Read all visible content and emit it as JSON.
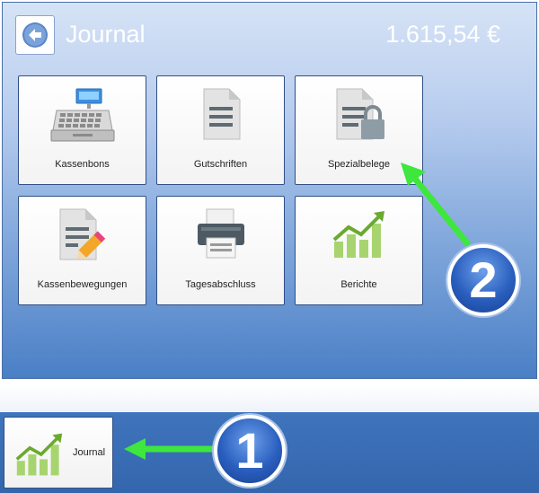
{
  "header": {
    "back_icon": "back-arrow-icon",
    "title": "Journal",
    "amount": "1.615,54 €"
  },
  "tiles": [
    {
      "label": "Kassenbons",
      "icon": "cash-register-icon"
    },
    {
      "label": "Gutschriften",
      "icon": "document-icon"
    },
    {
      "label": "Spezialbelege",
      "icon": "locked-document-icon"
    },
    {
      "label": "Kassenbewegungen",
      "icon": "document-edit-icon"
    },
    {
      "label": "Tagesabschluss",
      "icon": "printer-icon"
    },
    {
      "label": "Berichte",
      "icon": "chart-trend-icon"
    }
  ],
  "taskbar": {
    "journal_label": "Journal",
    "journal_icon": "chart-trend-icon"
  },
  "annotations": [
    {
      "number": "1",
      "color": "#2a5fbf"
    },
    {
      "number": "2",
      "color": "#2a5fbf"
    }
  ],
  "colors": {
    "arrow": "#33e033",
    "accent_blue": "#4a7fc6",
    "chart_green": "#8bc34a"
  }
}
